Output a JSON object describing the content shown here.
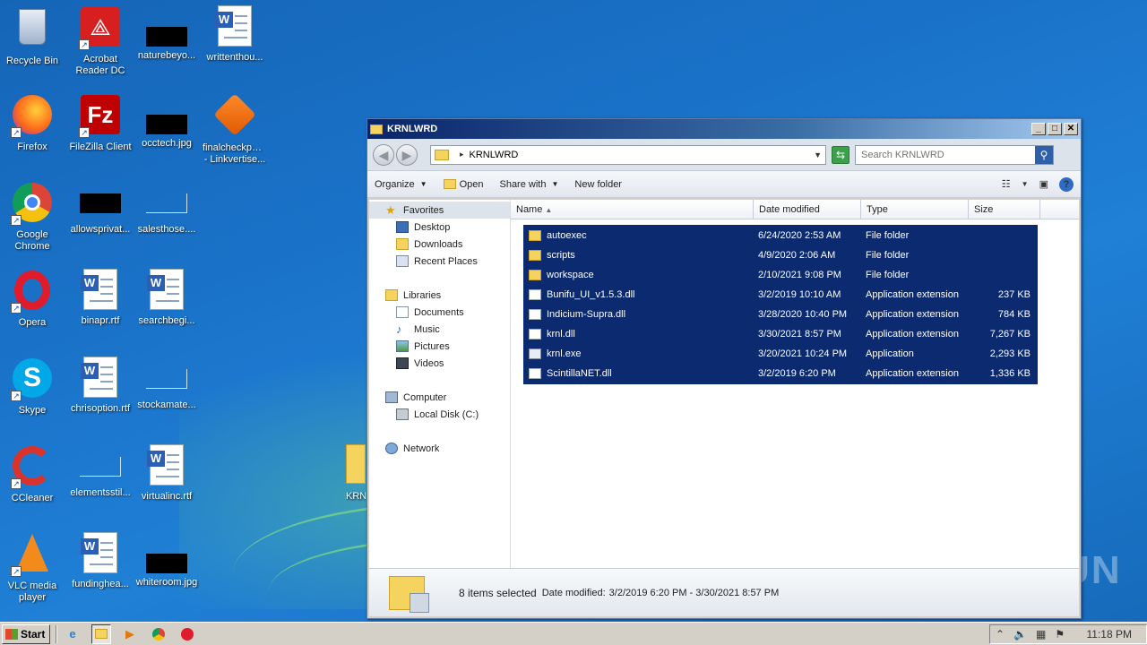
{
  "desktop": {
    "icons": [
      {
        "label": "Recycle Bin"
      },
      {
        "label": "Acrobat Reader DC"
      },
      {
        "label": "naturebeyo..."
      },
      {
        "label": "writtenthou..."
      },
      {
        "label": "Firefox"
      },
      {
        "label": "FileZilla Client"
      },
      {
        "label": "occtech.jpg"
      },
      {
        "label": "finalcheckpoint - Linkvertise..."
      },
      {
        "label": "Google Chrome"
      },
      {
        "label": "allowsprivat..."
      },
      {
        "label": "salesthose...."
      },
      {
        "label": "Opera"
      },
      {
        "label": "binapr.rtf"
      },
      {
        "label": "searchbegi..."
      },
      {
        "label": "Skype"
      },
      {
        "label": "chrisoption.rtf"
      },
      {
        "label": "stockamate..."
      },
      {
        "label": "CCleaner"
      },
      {
        "label": "elementsstil..."
      },
      {
        "label": "virtualinc.rtf"
      },
      {
        "label": "VLC media player"
      },
      {
        "label": "fundinghea..."
      },
      {
        "label": "whiteroom.jpg"
      },
      {
        "label": "KRNL"
      }
    ]
  },
  "window": {
    "title": "KRNLWRD",
    "address": {
      "path": "KRNLWRD"
    },
    "search": {
      "placeholder": "Search KRNLWRD"
    },
    "toolbar": {
      "organize": "Organize",
      "open": "Open",
      "share_with": "Share with",
      "new_folder": "New folder"
    },
    "nav": {
      "favorites": "Favorites",
      "desktop": "Desktop",
      "downloads": "Downloads",
      "recent_places": "Recent Places",
      "libraries": "Libraries",
      "documents": "Documents",
      "music": "Music",
      "pictures": "Pictures",
      "videos": "Videos",
      "computer": "Computer",
      "local_disk": "Local Disk (C:)",
      "network": "Network"
    },
    "columns": {
      "name": "Name",
      "date": "Date modified",
      "type": "Type",
      "size": "Size"
    },
    "files": [
      {
        "name": "autoexec",
        "date": "6/24/2020 2:53 AM",
        "type": "File folder",
        "size": "",
        "kind": "folder"
      },
      {
        "name": "scripts",
        "date": "4/9/2020 2:06 AM",
        "type": "File folder",
        "size": "",
        "kind": "folder"
      },
      {
        "name": "workspace",
        "date": "2/10/2021 9:08 PM",
        "type": "File folder",
        "size": "",
        "kind": "folder"
      },
      {
        "name": "Bunifu_UI_v1.5.3.dll",
        "date": "3/2/2019 10:10 AM",
        "type": "Application extension",
        "size": "237 KB",
        "kind": "dll"
      },
      {
        "name": "Indicium-Supra.dll",
        "date": "3/28/2020 10:40 PM",
        "type": "Application extension",
        "size": "784 KB",
        "kind": "dll"
      },
      {
        "name": "krnl.dll",
        "date": "3/30/2021 8:57 PM",
        "type": "Application extension",
        "size": "7,267 KB",
        "kind": "dll"
      },
      {
        "name": "krnl.exe",
        "date": "3/20/2021 10:24 PM",
        "type": "Application",
        "size": "2,293 KB",
        "kind": "exe"
      },
      {
        "name": "ScintillaNET.dll",
        "date": "3/2/2019 6:20 PM",
        "type": "Application extension",
        "size": "1,336 KB",
        "kind": "dll"
      }
    ],
    "details": {
      "count": "8 items selected",
      "modified_label": "Date modified:",
      "modified_range": "3/2/2019 6:20 PM - 3/30/2021 8:57 PM"
    }
  },
  "taskbar": {
    "start": "Start",
    "clock": "11:18 PM"
  },
  "watermark": "ANY RUN"
}
